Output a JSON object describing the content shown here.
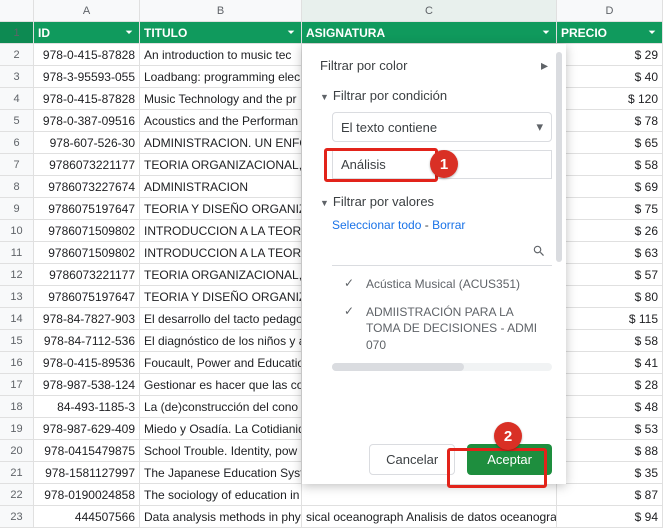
{
  "columns": {
    "rowhead": "",
    "A": "A",
    "B": "B",
    "C": "C",
    "D": "D"
  },
  "headers": {
    "A": "ID",
    "B": "TITULO",
    "C": "ASIGNATURA",
    "D": "PRECIO"
  },
  "rows": [
    {
      "n": "2",
      "id": "978-0-415-87828",
      "title": "An introduction to music tec",
      "subj": "",
      "price": "$ 29"
    },
    {
      "n": "3",
      "id": "978-3-95593-055",
      "title": "Loadbang: programming elec",
      "subj": "",
      "price": "$ 40"
    },
    {
      "n": "4",
      "id": "978-0-415-87828",
      "title": "Music Technology and the pr",
      "subj": "",
      "price": "$ 120"
    },
    {
      "n": "5",
      "id": "978-0-387-09516",
      "title": "Acoustics and the Performan",
      "subj": "",
      "price": "$ 78"
    },
    {
      "n": "6",
      "id": "978-607-526-30",
      "title": "ADMINISTRACION. UN ENFOC",
      "subj": "",
      "price": "$ 65"
    },
    {
      "n": "7",
      "id": "9786073221177",
      "title": "TEORIA ORGANIZACIONAL, D",
      "subj": "",
      "price": "$ 58"
    },
    {
      "n": "8",
      "id": "9786073227674",
      "title": "ADMINISTRACION",
      "subj": "",
      "price": "$ 69"
    },
    {
      "n": "9",
      "id": "9786075197647",
      "title": "TEORIA Y DISEÑO ORGANIZA",
      "subj": "",
      "price": "$ 75"
    },
    {
      "n": "10",
      "id": "9786071509802",
      "title": "INTRODUCCION A LA TEORIA",
      "subj": "",
      "price": "$ 26"
    },
    {
      "n": "11",
      "id": "9786071509802",
      "title": "INTRODUCCION A LA TEORIA",
      "subj": "",
      "price": "$ 63"
    },
    {
      "n": "12",
      "id": "9786073221177",
      "title": "TEORIA ORGANIZACIONAL, D",
      "subj": "",
      "price": "$ 57"
    },
    {
      "n": "13",
      "id": "9786075197647",
      "title": "TEORIA Y DISEÑO ORGANIZA",
      "subj": "",
      "price": "$ 80"
    },
    {
      "n": "14",
      "id": "978-84-7827-903",
      "title": "El desarrollo del tacto pedago",
      "subj": "",
      "price": "$ 115"
    },
    {
      "n": "15",
      "id": "978-84-7112-536",
      "title": "El diagnóstico de los niños y a",
      "subj": "",
      "price": "$ 58"
    },
    {
      "n": "16",
      "id": "978-0-415-89536",
      "title": "Foucault, Power and Educatio",
      "subj": "",
      "price": "$ 41"
    },
    {
      "n": "17",
      "id": "978-987-538-124",
      "title": "Gestionar es hacer que las co",
      "subj": "",
      "price": "$ 28"
    },
    {
      "n": "18",
      "id": "84-493-1185-3",
      "title": "La (de)construcción del cono",
      "subj": "",
      "price": "$ 48"
    },
    {
      "n": "19",
      "id": "978-987-629-409",
      "title": "Miedo y Osadía. La Cotidianid",
      "subj": "",
      "price": "$ 53"
    },
    {
      "n": "20",
      "id": "978-0415479875",
      "title": "School Trouble. Identity, pow",
      "subj": "",
      "price": "$ 88"
    },
    {
      "n": "21",
      "id": "978-1581127997",
      "title": "The Japanese Education Syst",
      "subj": "",
      "price": "$ 35"
    },
    {
      "n": "22",
      "id": "978-0190024858",
      "title": "The sociology of education in",
      "subj": "",
      "price": "$ 87"
    },
    {
      "n": "23",
      "id": "444507566",
      "title": "Data analysis methods in phy",
      "subj": "sical oceanograph Analisis de datos oceanograficos",
      "price": "$ 94"
    }
  ],
  "filter": {
    "by_color": "Filtrar por color",
    "by_condition": "Filtrar por condición",
    "condition_select": "El texto contiene",
    "condition_value": "Análisis",
    "by_values": "Filtrar por valores",
    "select_all": "Seleccionar todo",
    "clear": "Borrar",
    "sep": " - ",
    "values": [
      {
        "label": "Acústica Musical (ACUS351)",
        "checked": true
      },
      {
        "label": "ADMIISTRACIÓN PARA LA TOMA DE DECISIONES - ADMI 070",
        "checked": true
      }
    ],
    "cancel": "Cancelar",
    "accept": "Aceptar"
  },
  "badges": {
    "one": "1",
    "two": "2"
  }
}
